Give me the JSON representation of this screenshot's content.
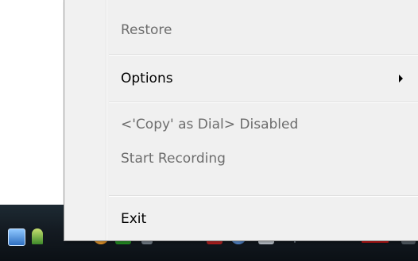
{
  "context_menu": {
    "items": [
      {
        "label": "Restore",
        "enabled": false
      },
      {
        "label": "Options",
        "enabled": true,
        "has_submenu": true
      },
      {
        "label": "<'Copy' as Dial> Disabled",
        "enabled": false
      },
      {
        "label": "Start Recording",
        "enabled": false
      },
      {
        "label": "Exit",
        "enabled": true
      }
    ]
  },
  "taskbar": {
    "tray_icons": [
      "app-window-icon",
      "figure-icon",
      "orange-circle-icon",
      "green-app-icon",
      "network-icon",
      "red-app-icon",
      "globe-icon",
      "white-app-icon",
      "red-bar-icon",
      "gray-app-icon"
    ]
  },
  "colors": {
    "menu_background": "#f0f0f0",
    "disabled_text": "#6d6d6d",
    "enabled_text": "#000000",
    "taskbar": "#141b22"
  }
}
